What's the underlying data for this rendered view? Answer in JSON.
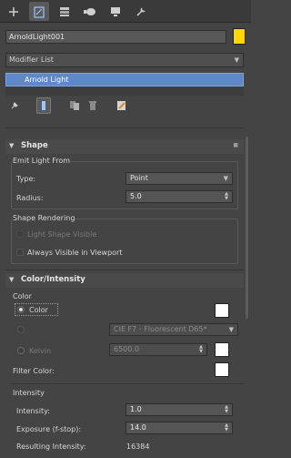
{
  "object": {
    "name": "ArnoldLight001",
    "color": "#ffd800"
  },
  "modifier_list": {
    "label": "Modifier List"
  },
  "stack": {
    "item": "Arnold Light"
  },
  "shape": {
    "title": "Shape",
    "emit_group": "Emit Light From",
    "type_label": "Type:",
    "type_value": "Point",
    "radius_label": "Radius:",
    "radius_value": "5.0",
    "rendering_group": "Shape Rendering",
    "light_shape_visible": "Light Shape Visible",
    "always_visible": "Always Visible in Viewport"
  },
  "color_intensity": {
    "title": "Color/Intensity",
    "color_group": "Color",
    "color_option": "Color",
    "preset_value": "CIE F7 - Fluorescent D65*",
    "kelvin_label": "Kelvin",
    "kelvin_value": "6500.0",
    "filter_color_label": "Filter Color:",
    "intensity_group": "Intensity",
    "intensity_label": "Intensity:",
    "intensity_value": "1.0",
    "exposure_label": "Exposure (f-stop):",
    "exposure_value": "14.0",
    "resulting_label": "Resulting Intensity:",
    "resulting_value": "16384"
  }
}
